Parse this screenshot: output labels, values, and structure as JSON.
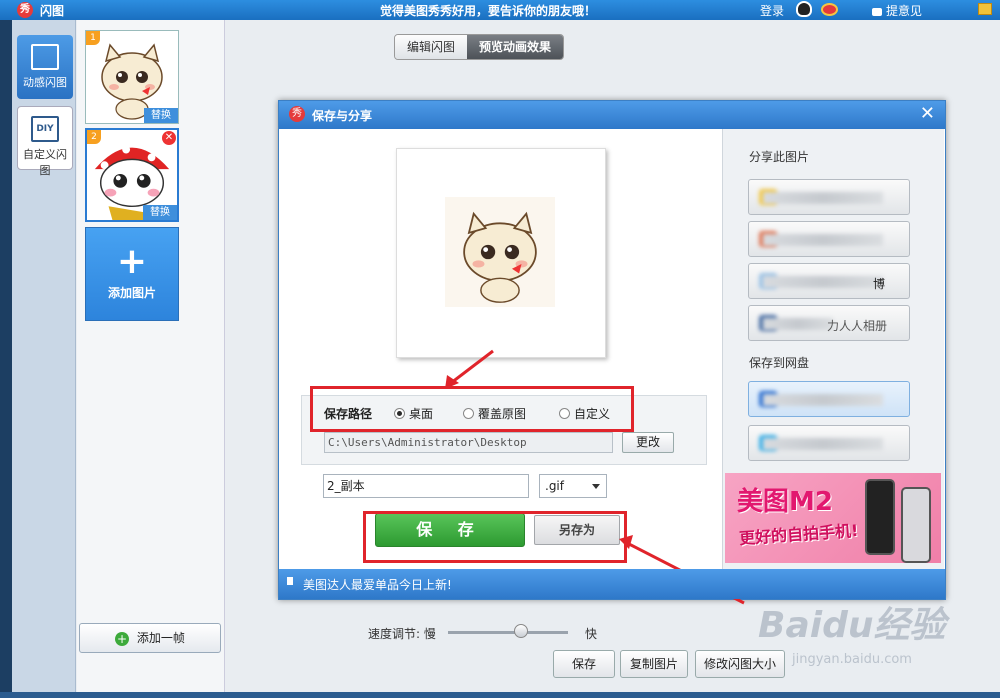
{
  "titlebar": {
    "logo_char": "秀",
    "app_name": "闪图",
    "slogan": "觉得美图秀秀好用，要告诉你的朋友哦！",
    "login": "登录",
    "feedback": "提意见"
  },
  "mode_nav": {
    "items": [
      {
        "label": "动感闪图",
        "active": true
      },
      {
        "label": "自定义闪图",
        "icon_text": "DIY",
        "active": false
      }
    ]
  },
  "frames": [
    {
      "number": "1",
      "replace_label": "替换",
      "selected": false
    },
    {
      "number": "2",
      "replace_label": "替换",
      "selected": true,
      "delete": "✕"
    }
  ],
  "add_picture": {
    "plus": "+",
    "label": "添加图片"
  },
  "add_frame": {
    "plus": "+",
    "label": "添加一帧"
  },
  "view_tabs": [
    {
      "label": "编辑闪图",
      "active": false
    },
    {
      "label": "预览动画效果",
      "active": true
    }
  ],
  "dialog": {
    "logo_char": "秀",
    "title": "保存与分享",
    "close": "✕",
    "save_path_label": "保存路径",
    "path_options": [
      {
        "label": "桌面",
        "selected": true
      },
      {
        "label": "覆盖原图",
        "selected": false
      },
      {
        "label": "自定义",
        "selected": false
      }
    ],
    "path_value": "C:\\Users\\Administrator\\Desktop",
    "change_button": "更改",
    "filename": "2_副本",
    "extension": ".gif",
    "save_button": "保 存",
    "save_as_button": "另存为",
    "share_heading": "分享此图片",
    "share_buttons": [
      {
        "icon_color": "#f2c94c"
      },
      {
        "icon_color": "#e07a5a"
      },
      {
        "icon_color": "#9cc3e6",
        "text": "博"
      },
      {
        "icon_color": "#4a6fa5",
        "text": "力人人相册"
      }
    ],
    "netdisk_heading": "保存到网盘",
    "netdisk_buttons": [
      {
        "icon_color": "#2a6fd2",
        "highlighted": true
      },
      {
        "icon_color": "#3ab0e8",
        "highlighted": false
      }
    ],
    "ad": {
      "title": "美图M2",
      "subtitle": "更好的自拍手机!"
    },
    "footer_message": "美图达人最爱单品今日上新!"
  },
  "speed": {
    "label": "速度调节: 慢",
    "fast_label": "快",
    "value": 0.55
  },
  "bottom_buttons": [
    {
      "label": "保存"
    },
    {
      "label": "复制图片"
    },
    {
      "label": "修改闪图大小"
    }
  ],
  "watermark": {
    "logo": "Baidu经验",
    "url": "jingyan.baidu.com"
  },
  "colors": {
    "accent_blue": "#2e78c9",
    "save_green": "#2d9a31",
    "annotation_red": "#e0242b"
  }
}
